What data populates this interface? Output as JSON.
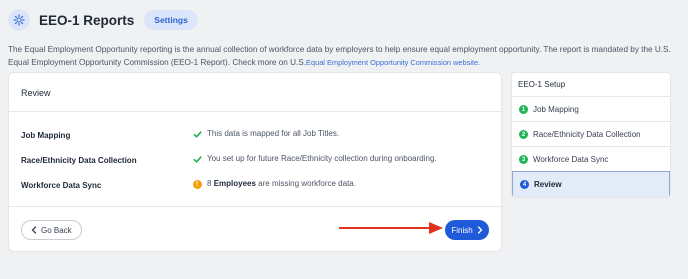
{
  "header": {
    "title": "EEO-1 Reports",
    "settings_label": "Settings",
    "icon": "gear-icon"
  },
  "description": {
    "text": "The Equal Employment Opportunity reporting is the annual collection of workforce data by employers to help ensure equal employment opportunity. The report is mandated by the U.S. Equal Employment Opportunity Commission (EEO-1 Report). Check more on U.S.",
    "link_text": "Equal Employment Opportunity Commission website."
  },
  "review": {
    "title": "Review",
    "rows": [
      {
        "label": "Job Mapping",
        "status": "check",
        "text": "This data is mapped for all Job Titles."
      },
      {
        "label": "Race/Ethnicity Data Collection",
        "status": "check",
        "text": "You set up for future Race/Ethnicity collection during onboarding."
      },
      {
        "label": "Workforce Data Sync",
        "status": "warning",
        "count": "8",
        "bold": "Employees",
        "text": " are missing workforce data."
      }
    ],
    "go_back_label": "Go Back",
    "finish_label": "Finish"
  },
  "setup": {
    "title": "EEO-1 Setup",
    "steps": [
      {
        "number": "1",
        "label": "Job Mapping",
        "state": "done"
      },
      {
        "number": "2",
        "label": "Race/Ethnicity Data Collection",
        "state": "done"
      },
      {
        "number": "3",
        "label": "Workforce Data Sync",
        "state": "done"
      },
      {
        "number": "4",
        "label": "Review",
        "state": "current"
      }
    ]
  },
  "colors": {
    "primary": "#1f5bd8",
    "success": "#22b455",
    "warning": "#f59e0b",
    "annotation_arrow": "#e0301e"
  }
}
